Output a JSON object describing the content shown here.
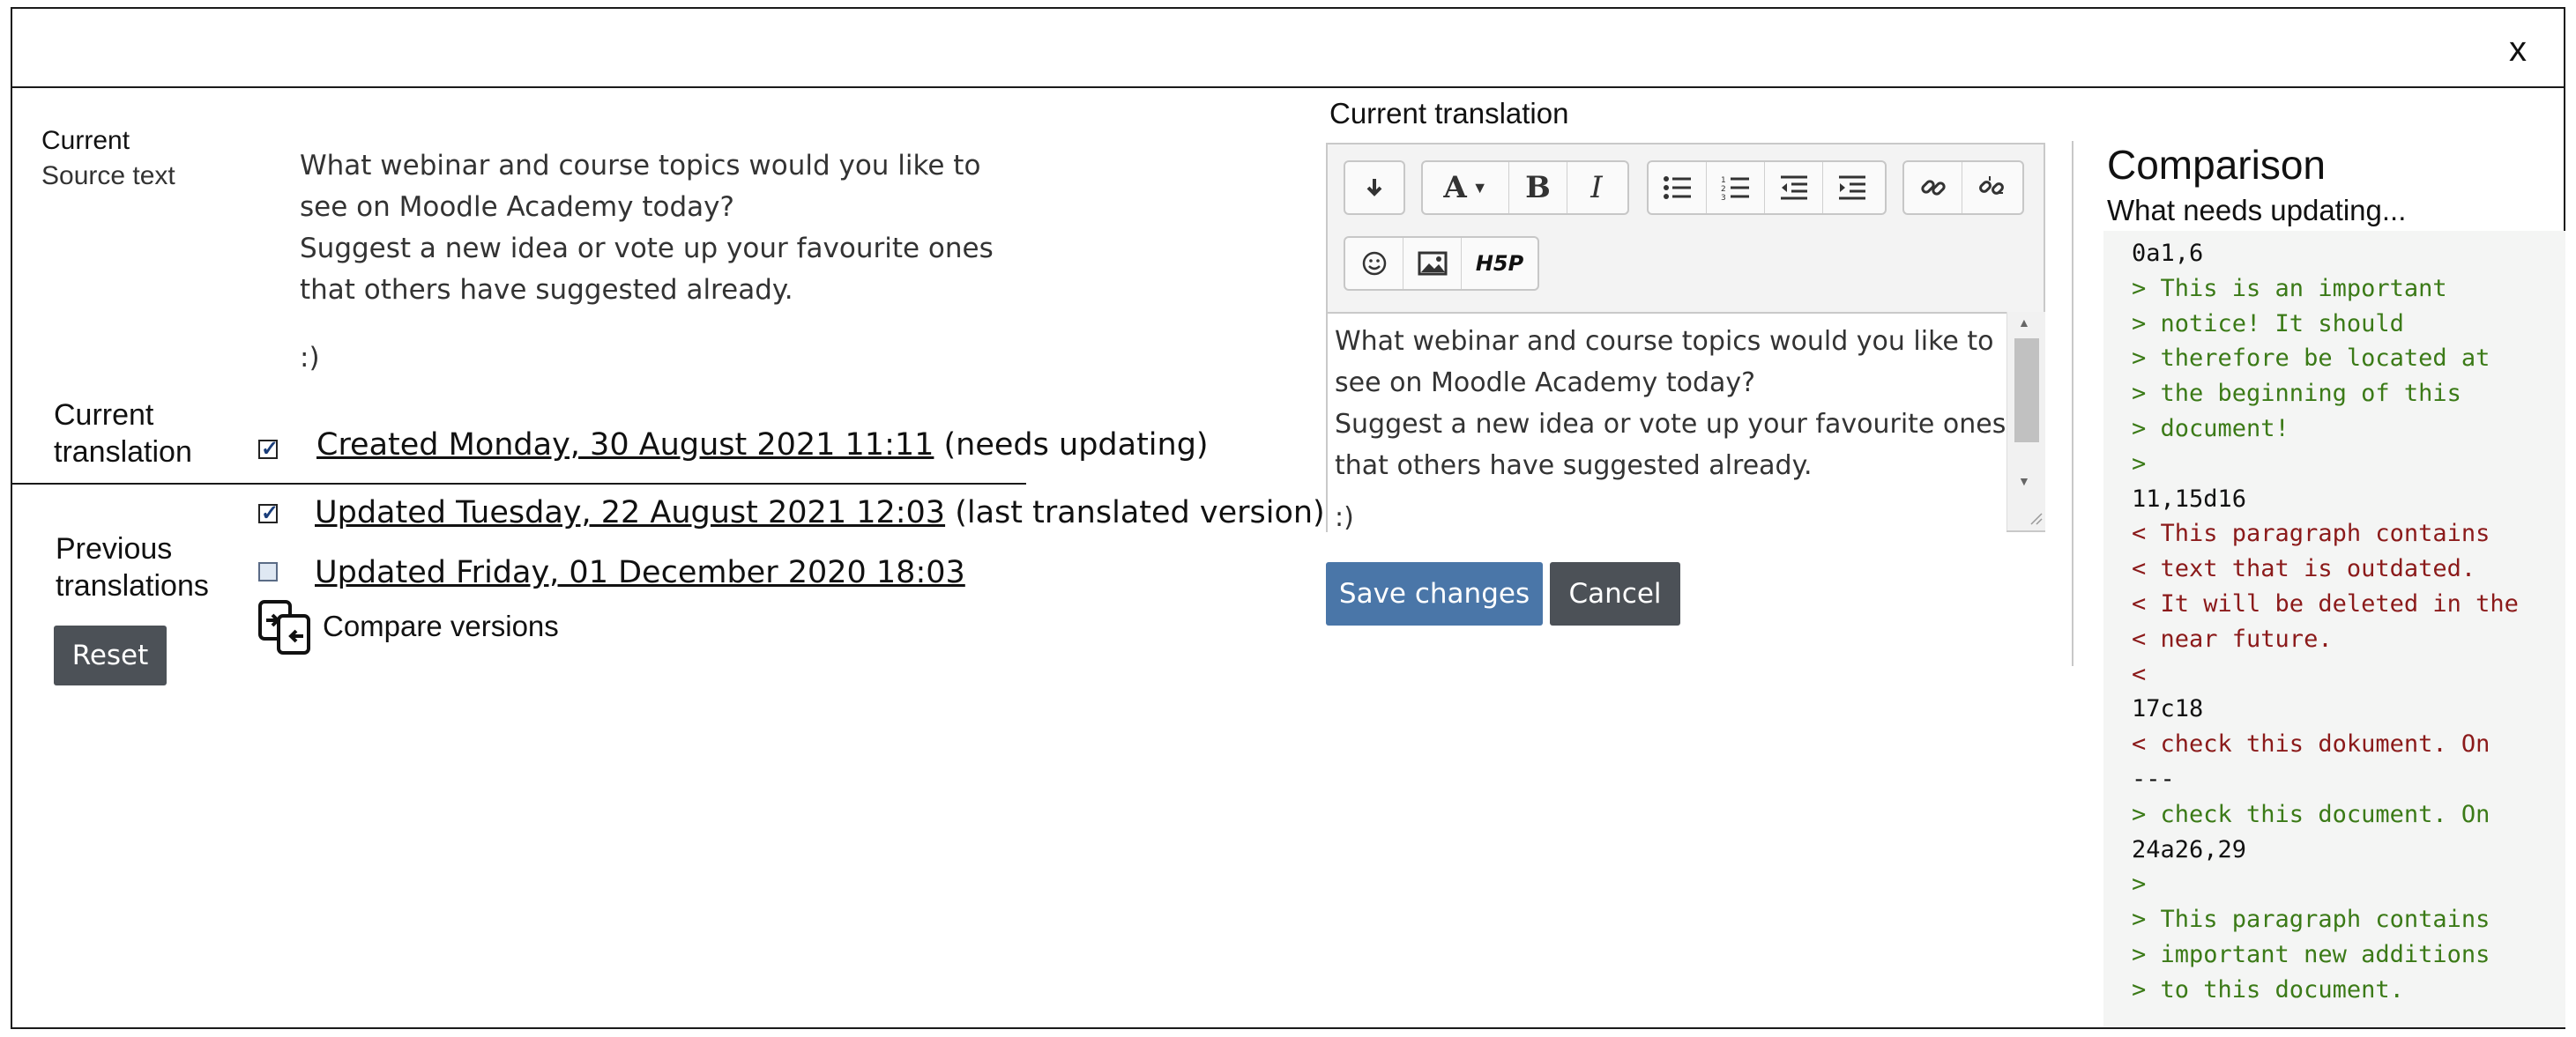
{
  "dialog": {
    "close_label": "x"
  },
  "source": {
    "label_line1": "Current",
    "label_line2": "Source text",
    "paragraph1": "What webinar and course topics would you like to see on Moodle Academy today?",
    "paragraph2": "Suggest a new idea or vote up your favourite ones that others have suggested already.",
    "paragraph3": ":)"
  },
  "current_translation": {
    "label_line1": "Current",
    "label_line2": "translation",
    "checked": true,
    "link_text": "Created Monday, 30 August 2021 11:11",
    "status": " (needs updating)"
  },
  "previous_translations": {
    "label_line1": "Previous",
    "label_line2": "translations",
    "reset_label": "Reset",
    "items": [
      {
        "checked": true,
        "link_text": "Updated Tuesday, 22 August 2021 12:03",
        "status": " (last translated version)"
      },
      {
        "checked": false,
        "link_text": "Updated Friday, 01 December 2020 18:03",
        "status": ""
      }
    ],
    "compare_label": "Compare versions"
  },
  "editor": {
    "heading": "Current translation",
    "toolbar_icons": [
      "return-icon",
      "font-icon",
      "bold-icon",
      "italic-icon",
      "unordered-list-icon",
      "ordered-list-icon",
      "outdent-icon",
      "indent-icon",
      "link-icon",
      "unlink-icon",
      "emoji-icon",
      "image-icon",
      "h5p-icon"
    ],
    "bold_glyph": "B",
    "italic_glyph": "I",
    "font_glyph": "A",
    "h5p_glyph": "H5P",
    "content_p1": "What webinar and course topics would you like to see on Moodle Academy today?",
    "content_p2": "Suggest a new idea or vote up your favourite ones that others have suggested already.",
    "content_p3": ":)"
  },
  "actions": {
    "save_label": "Save changes",
    "cancel_label": "Cancel"
  },
  "comparison": {
    "title": "Comparison",
    "subtitle": "What needs updating...",
    "colors": {
      "added": "#3b7a17",
      "removed": "#8b1a1a",
      "header": "#111111"
    },
    "lines": [
      {
        "text": "0a1,6",
        "kind": "header"
      },
      {
        "text": "> This is an important",
        "kind": "added"
      },
      {
        "text": "> notice! It should",
        "kind": "added"
      },
      {
        "text": "> therefore be located at",
        "kind": "added"
      },
      {
        "text": "> the beginning of this",
        "kind": "added"
      },
      {
        "text": "> document!",
        "kind": "added"
      },
      {
        "text": ">",
        "kind": "added"
      },
      {
        "text": "11,15d16",
        "kind": "header"
      },
      {
        "text": "< This paragraph contains",
        "kind": "removed"
      },
      {
        "text": "< text that is outdated.",
        "kind": "removed"
      },
      {
        "text": "< It will be deleted in the",
        "kind": "removed"
      },
      {
        "text": "< near future.",
        "kind": "removed"
      },
      {
        "text": "<",
        "kind": "removed"
      },
      {
        "text": "17c18",
        "kind": "header"
      },
      {
        "text": "< check this dokument. On",
        "kind": "removed"
      },
      {
        "text": "---",
        "kind": "header"
      },
      {
        "text": "> check this document. On",
        "kind": "added"
      },
      {
        "text": "24a26,29",
        "kind": "header"
      },
      {
        "text": ">",
        "kind": "added"
      },
      {
        "text": "> This paragraph contains",
        "kind": "added"
      },
      {
        "text": "> important new additions",
        "kind": "added"
      },
      {
        "text": "> to this document.",
        "kind": "added"
      }
    ]
  }
}
